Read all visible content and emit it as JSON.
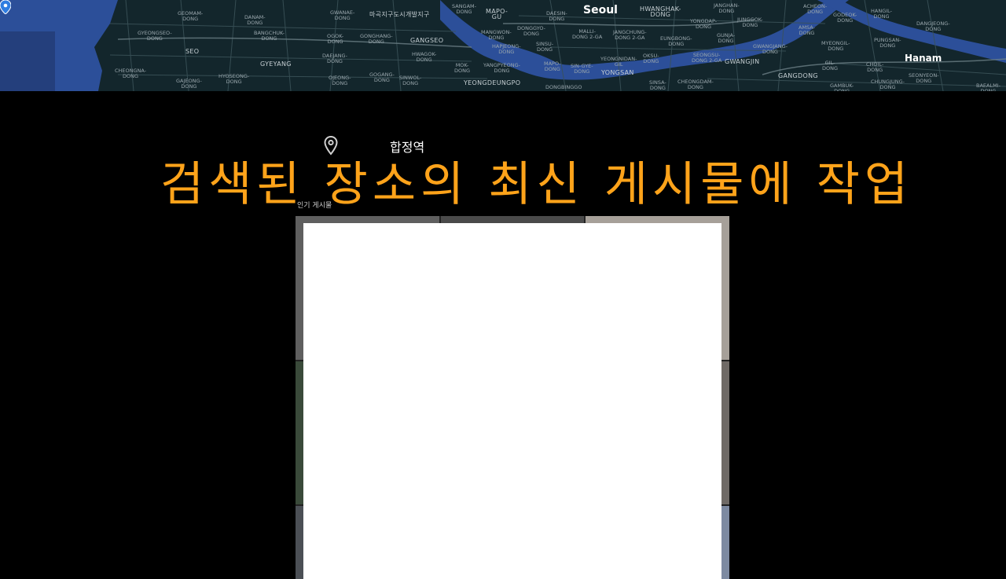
{
  "map": {
    "city": "Seoul",
    "suburb": "Hanam",
    "districts": [
      "SEO",
      "GYEYANG",
      "GANGSEO",
      "MAPO-\nGU",
      "YONGSAN",
      "GWANGJIN",
      "GANGDONG",
      "YEONGDEUNGPO",
      "HWANGHAK-\nDONG",
      "마곡지구도시개발지구"
    ],
    "neighborhoods": [
      "GEOMAM-\nDONG",
      "DANAM-\nDONG",
      "GWANAE-\nDONG",
      "SANGAM-\nDONG",
      "GYEONGSEO-\nDONG",
      "BANGCHUK-\nDONG",
      "OGOK-\nDONG",
      "GONGHANG-\nDONG",
      "CHEONGNA-\nDONG",
      "HYOSEONG-\nDONG",
      "GAJEONG-\nDONG",
      "DAEJANG-\nDONG",
      "OJEONG-\nDONG",
      "GOGANG-\nDONG",
      "HWAGOK-\nDONG",
      "SINWOL-\nDONG",
      "MANGWON-\nDONG",
      "HAPJEONG-\nDONG",
      "DONGGYO-\nDONG",
      "DAESIN-\nDONG",
      "SINSU-\nDONG",
      "MALLI-\nDONG 2-GA",
      "MOK-\nDONG",
      "YANGPYEONG-\nDONG",
      "SIN-GYE-\nDONG",
      "JANGCHUNG-\nDONG 2-GA",
      "YEONGNIDAN-\nGIL",
      "OKSU-\nDONG",
      "EUNGBONG-\nDONG",
      "SEONGSU-\nDONG 2-GA",
      "YONGDAP-\nDONG",
      "GUNJA-\nDONG",
      "JUNGGOK-\nDONG",
      "GWANGJANG-\nDONG",
      "AMSA-\nDONG",
      "MYEONGIL-\nDONG",
      "GIL-\nDONG",
      "GAMBUK-\nDONG",
      "CHEONGDAM-\nDONG",
      "SINSA-\nDONG",
      "ACHEON-\nDONG",
      "GODEOK-\nDONG",
      "HANGIL-\nDONG",
      "JANGHAN-\nDONG",
      "CHOIL-\nDONG",
      "CHUNGJUNG-\nDONG",
      "SEONYEON-\nDONG",
      "PUNGSAN-\nDONG",
      "BAEALMI-\nDONG",
      "DANGJEONG-\nDONG",
      "MAPO-\nDONG",
      "DONGBINGGO"
    ]
  },
  "location": {
    "name": "합정역"
  },
  "overlay_caption": "검색된 장소의 최신 게시물에 작업",
  "section_label": "인기 게시물",
  "colors": {
    "accent": "#ffa31a",
    "background": "#000000",
    "map_water": "#2c4f99",
    "pin": "#2f7de1"
  },
  "icons": {
    "map_pin": "map-pin-icon",
    "location": "location-pin-icon"
  }
}
